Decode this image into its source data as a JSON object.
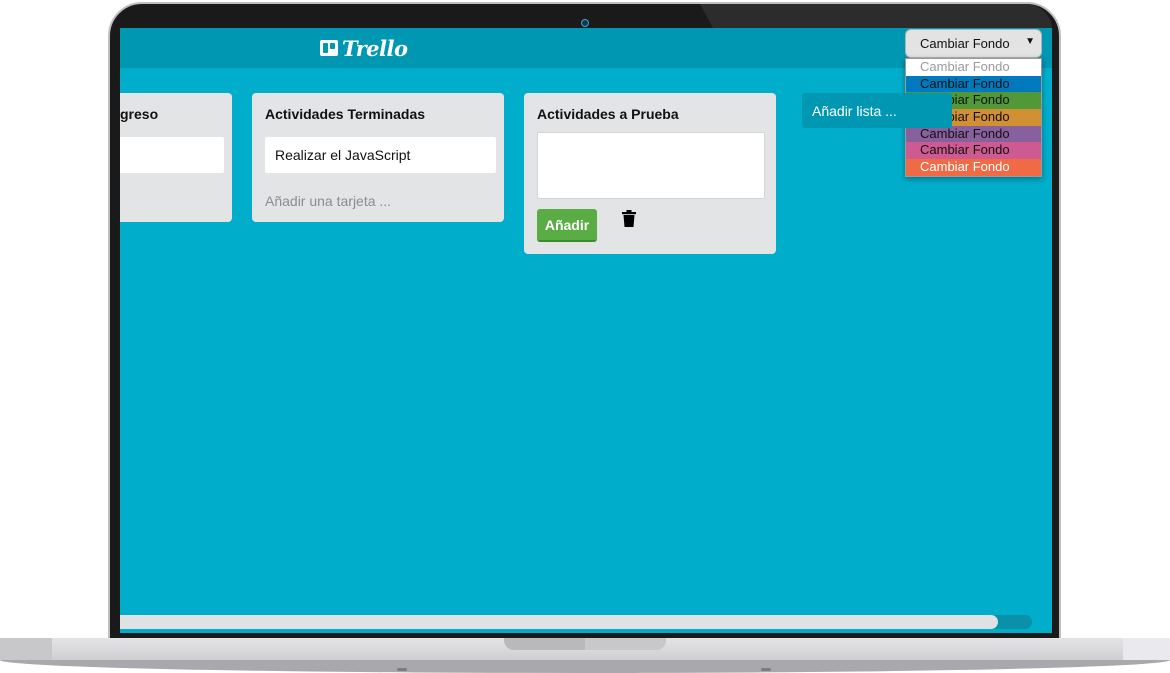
{
  "app": {
    "logo_text": "Trello"
  },
  "background_picker": {
    "selected": "Cambiar Fondo",
    "options": [
      {
        "label": "Cambiar Fondo",
        "bg": "#ffffff",
        "color": "#9a9a9a"
      },
      {
        "label": "Cambiar Fondo",
        "bg": "#0079bf",
        "color": "#111111"
      },
      {
        "label": "Cambiar Fondo",
        "bg": "#519839",
        "color": "#111111"
      },
      {
        "label": "Cambiar Fondo",
        "bg": "#d29034",
        "color": "#111111"
      },
      {
        "label": "Cambiar Fondo",
        "bg": "#89609e",
        "color": "#111111"
      },
      {
        "label": "Cambiar Fondo",
        "bg": "#cd5a91",
        "color": "#111111"
      },
      {
        "label": "Cambiar Fondo",
        "bg": "#f06a46",
        "color": "#ffffff"
      }
    ]
  },
  "lists": [
    {
      "title": "greso",
      "cards": [
        ""
      ],
      "add_card_label": ""
    },
    {
      "title": "Actividades Terminadas",
      "cards": [
        "Realizar el JavaScript"
      ],
      "add_card_label": "Añadir una tarjeta ..."
    },
    {
      "title": "Actividades a Prueba",
      "cards": [],
      "add_button_label": "Añadir",
      "trash_icon": "trash-icon"
    }
  ],
  "add_list_label": "Añadir lista ...",
  "colors": {
    "board_bg": "#00aecc",
    "header_bg": "#0097b2",
    "add_button": "#5aac44"
  }
}
